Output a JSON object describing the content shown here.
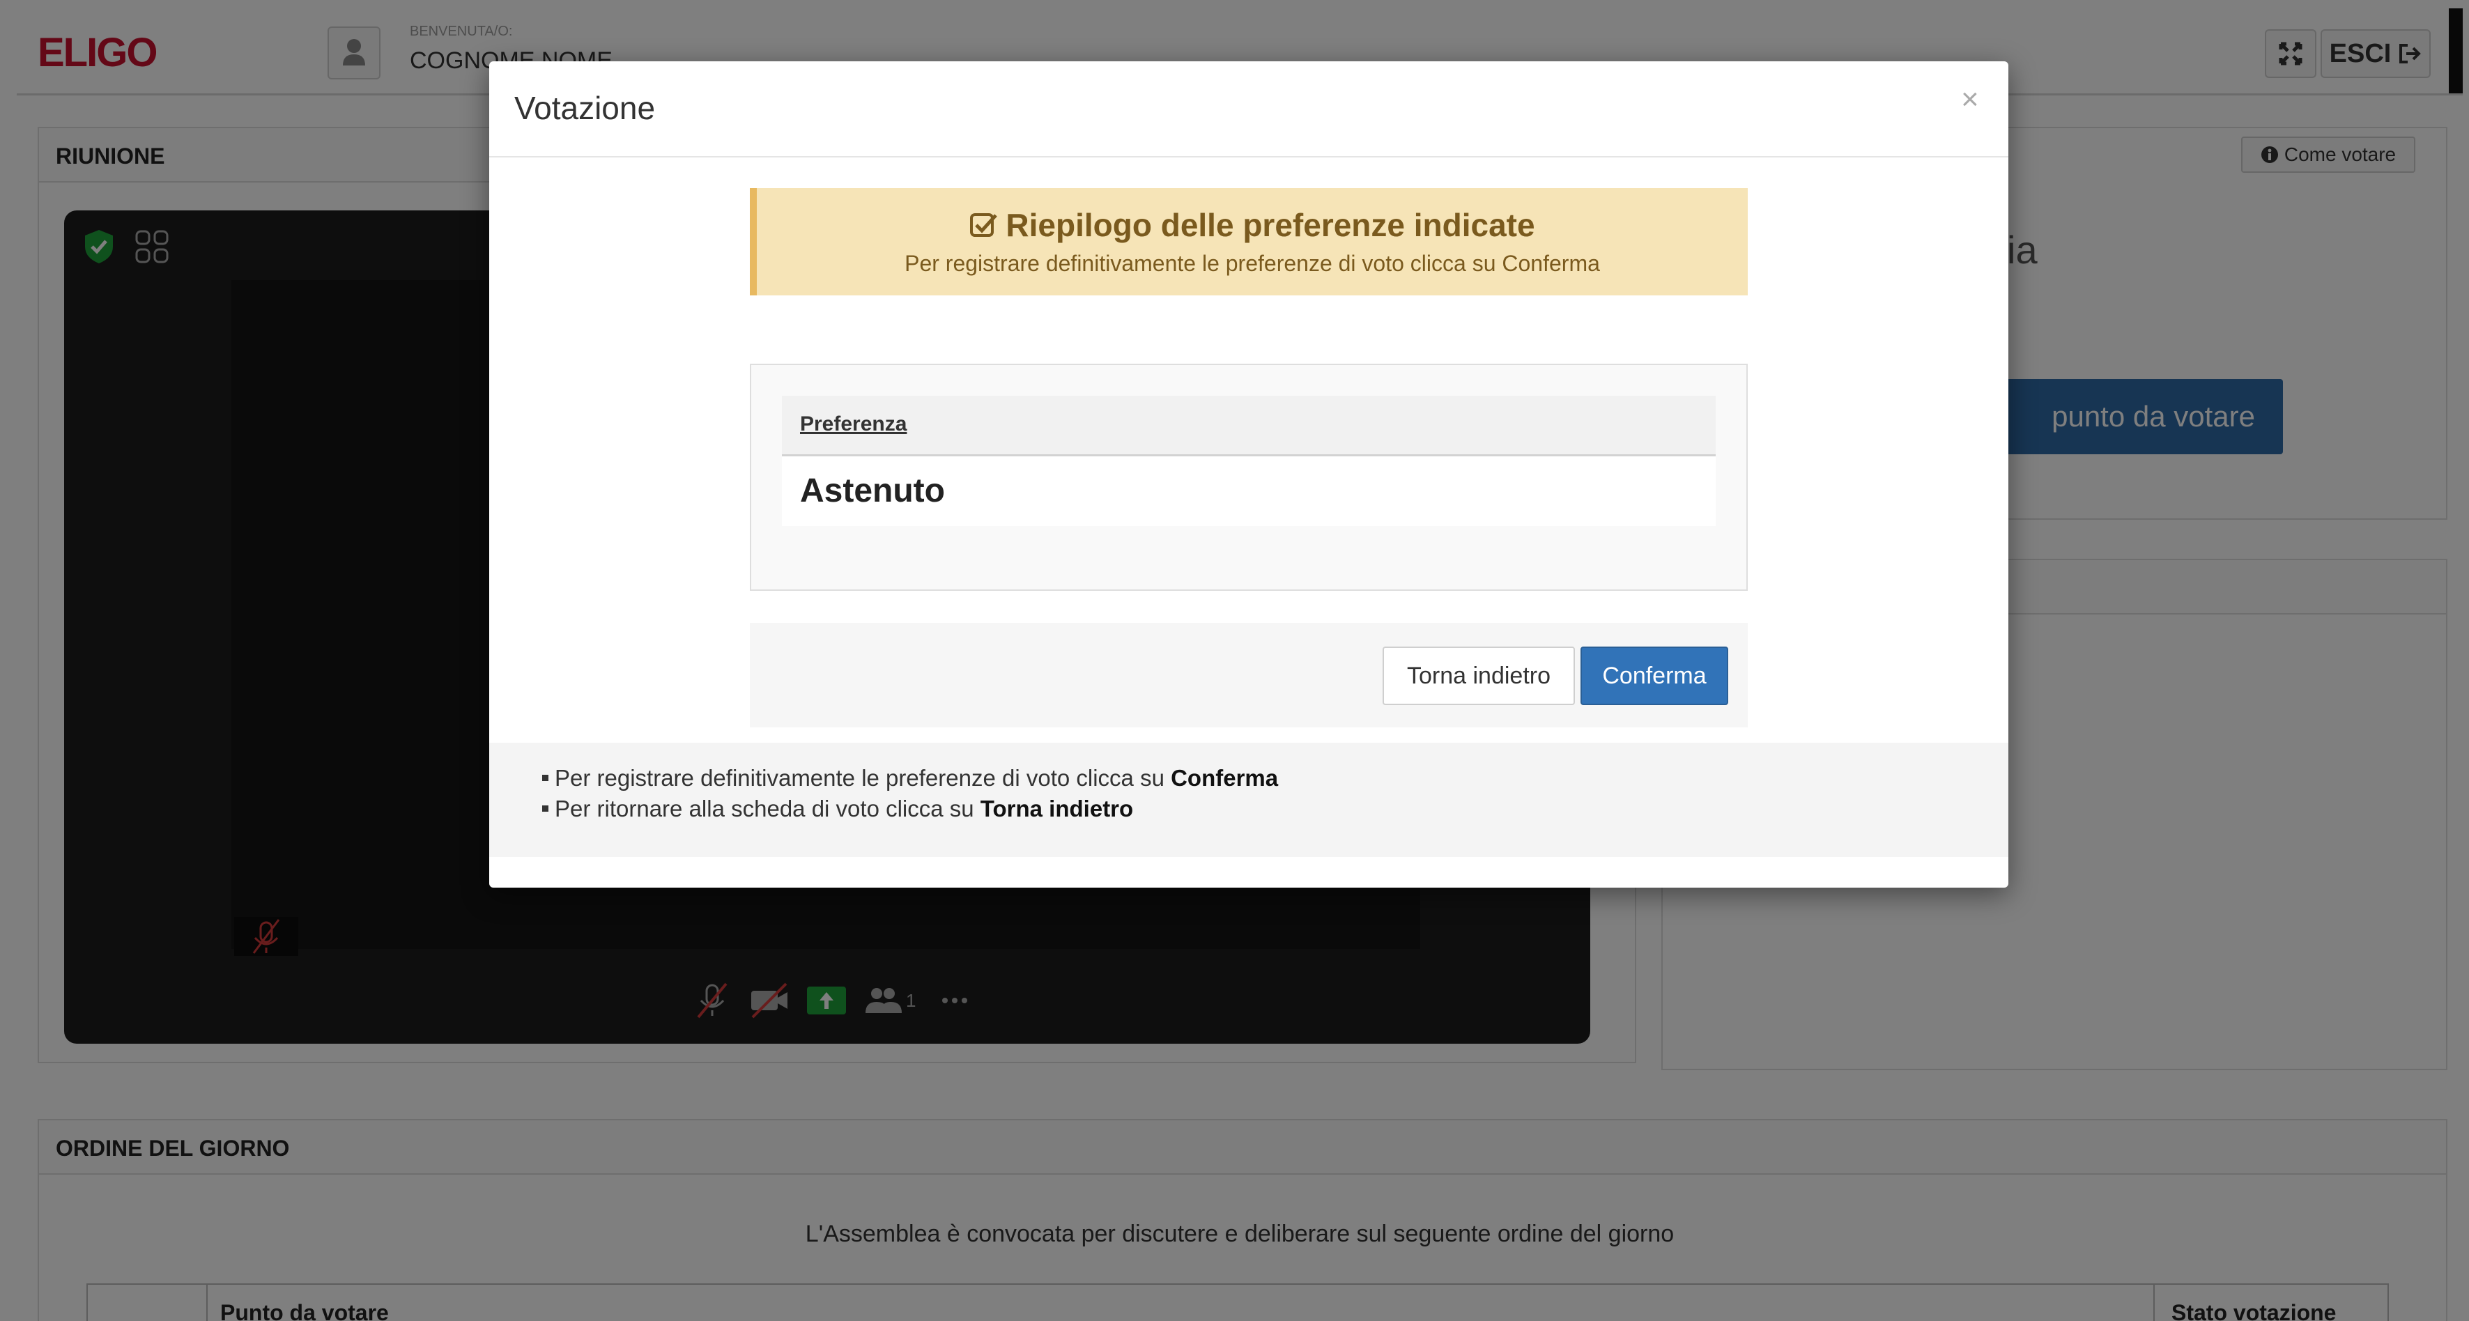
{
  "navbar": {
    "logo": "ELIGO",
    "welcome_label": "BENVENUTA/O:",
    "user_name": "COGNOME NOME",
    "exit_label": "ESCI"
  },
  "meeting_panel": {
    "title": "RIUNIONE"
  },
  "vote_panel": {
    "how_to_vote_label": "Come votare",
    "partial_title": "ia",
    "vote_button_partial": "punto da votare"
  },
  "agenda_panel": {
    "title": "ORDINE DEL GIORNO",
    "subtitle": "L'Assemblea è convocata per discutere e deliberare sul seguente ordine del giorno",
    "columns": [
      "Punto da votare",
      "Stato votazione"
    ]
  },
  "video": {
    "participants_count": "1"
  },
  "modal": {
    "title": "Votazione",
    "close_label": "×",
    "alert_title": "Riepilogo delle preferenze indicate",
    "alert_subtitle": "Per registrare definitivamente le preferenze di voto clicca su Conferma",
    "table_header": "Preferenza",
    "preference_value": "Astenuto",
    "back_button": "Torna indietro",
    "confirm_button": "Conferma",
    "help": [
      {
        "prefix": "Per registrare definitivamente le preferenze di voto clicca su ",
        "strong": "Conferma"
      },
      {
        "prefix": "Per ritornare alla scheda di voto clicca su ",
        "strong": "Torna indietro"
      }
    ]
  },
  "colors": {
    "brand": "#c8102e",
    "primary": "#3173b8",
    "alert_bg": "#f6e4b7",
    "alert_text": "#7a5a1e"
  }
}
